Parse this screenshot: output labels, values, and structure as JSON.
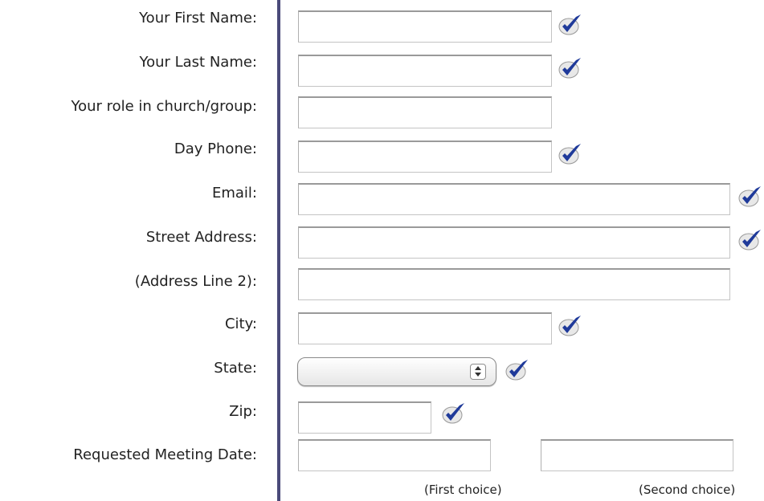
{
  "form": {
    "labels": {
      "first_name": "Your First Name:",
      "last_name": "Your Last Name:",
      "role": "Your role in church/group:",
      "day_phone": "Day Phone:",
      "email": "Email:",
      "street_address": "Street Address:",
      "address_line2": "(Address Line 2):",
      "city": "City:",
      "state": "State:",
      "zip": "Zip:",
      "meeting_date": "Requested Meeting Date:"
    },
    "values": {
      "first_name": "",
      "last_name": "",
      "role": "",
      "day_phone": "",
      "email": "",
      "street_address": "",
      "address_line2": "",
      "city": "",
      "state": "",
      "zip": "",
      "meeting_date_first": "",
      "meeting_date_second": ""
    },
    "hints": {
      "first_choice": "(First choice)",
      "second_choice": "(Second choice)"
    },
    "icons": {
      "required": "checkmark-icon"
    },
    "colors": {
      "divider": "#4a4a7a",
      "check_blue": "#1f3a9a"
    }
  }
}
